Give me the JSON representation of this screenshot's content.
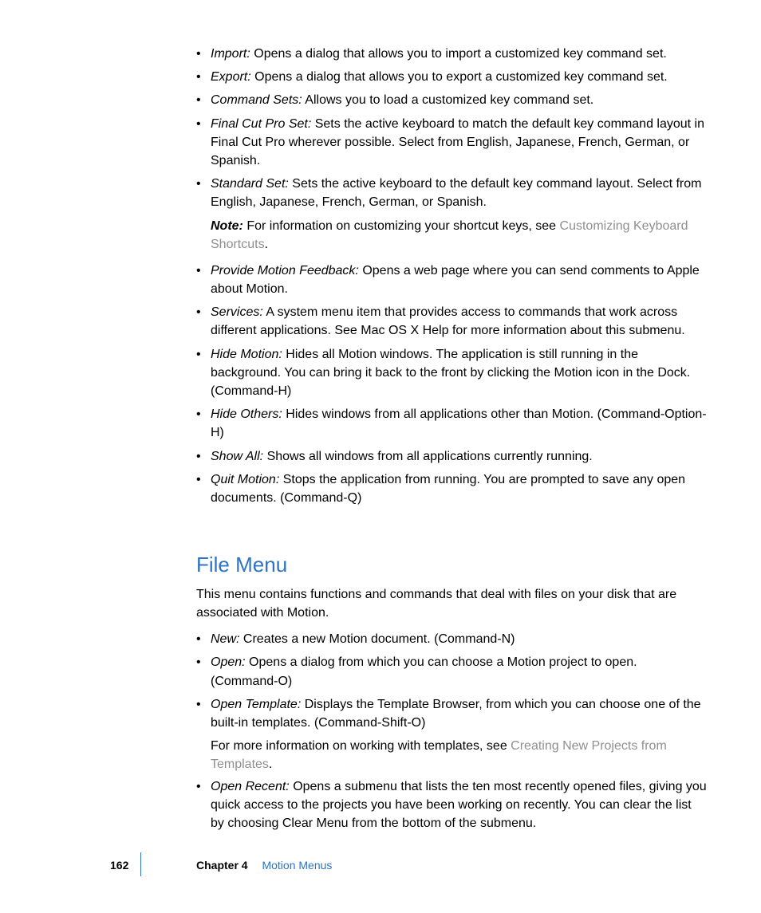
{
  "top_sublist": [
    {
      "term": "Import:",
      "body": "Opens a dialog that allows you to import a customized key command set."
    },
    {
      "term": "Export:",
      "body": "Opens a dialog that allows you to export a customized key command set."
    },
    {
      "term": "Command Sets:",
      "body": "Allows you to load a customized key command set."
    },
    {
      "term": "Final Cut Pro Set:",
      "body": "Sets the active keyboard to match the default key command layout in Final Cut Pro wherever possible. Select from English, Japanese, French, German, or Spanish."
    },
    {
      "term": "Standard Set:",
      "body": "Sets the active keyboard to the default key command layout. Select from English, Japanese, French, German, or Spanish."
    }
  ],
  "note": {
    "prefix": "Note:",
    "text_before": "For information on customizing your shortcut keys, see ",
    "link": "Customizing Keyboard Shortcuts",
    "text_after": "."
  },
  "outer_list": [
    {
      "term": "Provide Motion Feedback:",
      "body": "Opens a web page where you can send comments to Apple about Motion."
    },
    {
      "term": "Services:",
      "body": "A system menu item that provides access to commands that work across different applications. See Mac OS X Help for more information about this submenu."
    },
    {
      "term": "Hide Motion:",
      "body": "Hides all Motion windows. The application is still running in the background. You can bring it back to the front by clicking the Motion icon in the Dock. (Command-H)"
    },
    {
      "term": "Hide Others:",
      "body": "Hides windows from all applications other than Motion. (Command-Option-H)"
    },
    {
      "term": "Show All:",
      "body": "Shows all windows from all applications currently running."
    },
    {
      "term": "Quit Motion:",
      "body": "Stops the application from running. You are prompted to save any open documents. (Command-Q)"
    }
  ],
  "section": {
    "heading": "File Menu",
    "intro": "This menu contains functions and commands that deal with files on your disk that are associated with Motion."
  },
  "file_list_a": [
    {
      "term": "New:",
      "body": "Creates a new Motion document. (Command-N)"
    },
    {
      "term": "Open:",
      "body": "Opens a dialog from which you can choose a Motion project to open. (Command-O)"
    },
    {
      "term": "Open Template:",
      "body": "Displays the Template Browser, from which you can choose one of the built-in templates. (Command-Shift-O)"
    }
  ],
  "template_more": {
    "before": "For more information on working with templates, see ",
    "link": "Creating New Projects from Templates",
    "after": "."
  },
  "file_list_b": [
    {
      "term": "Open Recent:",
      "body": "Opens a submenu that lists the ten most recently opened files, giving you quick access to the projects you have been working on recently. You can clear the list by choosing Clear Menu from the bottom of the submenu."
    }
  ],
  "footer": {
    "page": "162",
    "chapter_label": "Chapter 4",
    "chapter_title": "Motion Menus"
  }
}
